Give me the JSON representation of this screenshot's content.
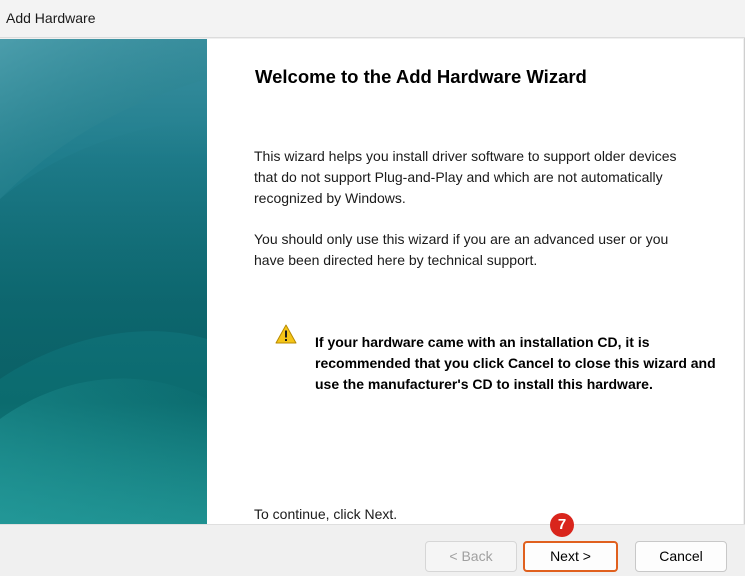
{
  "window": {
    "title": "Add Hardware"
  },
  "wizard": {
    "heading": "Welcome to the Add Hardware Wizard",
    "paragraph1": "This wizard helps you install driver software to support older devices that do not support Plug-and-Play and which are not automatically recognized by Windows.",
    "paragraph2": "You should only use this wizard if you are an advanced user or you have been directed here by technical support.",
    "warning": {
      "icon": "warning-icon",
      "text": "If your hardware came with an installation CD, it is recommended that you click Cancel to close this wizard and use the manufacturer's CD to install this hardware."
    },
    "continue_text": "To continue, click Next."
  },
  "buttons": {
    "back_label": "< Back",
    "back_enabled": false,
    "next_label": "Next >",
    "cancel_label": "Cancel"
  },
  "annotation": {
    "step_number": "7",
    "color": "#d9251c",
    "highlight_color": "#e0601e"
  },
  "colors": {
    "banner_teal": "#0f6f78",
    "content_bg": "#ffffff",
    "warning_yellow": "#f5c518"
  }
}
